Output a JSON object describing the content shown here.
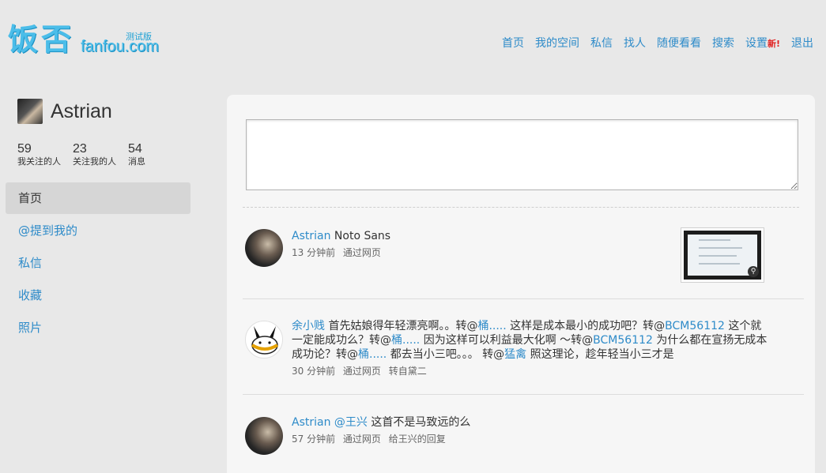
{
  "logo": {
    "cn": "饭否",
    "en": "fanfou.com",
    "beta": "测试版"
  },
  "nav": {
    "home": "首页",
    "my_space": "我的空间",
    "messages": "私信",
    "find_people": "找人",
    "browse": "随便看看",
    "search": "搜索",
    "settings": "设置",
    "settings_badge": "新!",
    "logout": "退出"
  },
  "profile": {
    "name": "Astrian"
  },
  "stats": [
    {
      "num": "59",
      "label": "我关注的人"
    },
    {
      "num": "23",
      "label": "关注我的人"
    },
    {
      "num": "54",
      "label": "消息"
    }
  ],
  "sidenav": [
    {
      "label": "首页",
      "active": true
    },
    {
      "label": "@提到我的"
    },
    {
      "label": "私信"
    },
    {
      "label": "收藏"
    },
    {
      "label": "照片"
    }
  ],
  "composer": {
    "placeholder": ""
  },
  "statuses": [
    {
      "user": "Astrian",
      "text": "Noto Sans",
      "time": "13 分钟前",
      "via": "通过网页"
    },
    {
      "user": "余小贱",
      "parts": [
        " 首先姑娘得年轻漂亮啊。。转@",
        "桶.....",
        " 这样是成本最小的成功吧？转@",
        "BCM56112",
        " 这个就一定能成功么？转@",
        "桶.....",
        " 因为这样可以利益最大化啊 ～转@",
        "BCM56112",
        " 为什么都在宣扬无成本成功论？转@",
        "桶.....",
        " 都去当小三吧。。。 转@",
        "猛禽",
        " 照这理论，趁年轻当小三才是"
      ],
      "time": "30 分钟前",
      "via": "通过网页",
      "extra": "转自黛二"
    },
    {
      "user": "Astrian",
      "mention": "@王兴",
      "text": " 这首不是马致远的么",
      "time": "57 分钟前",
      "via": "通过网页",
      "extra": "给王兴的回复"
    }
  ],
  "colors": {
    "link": "#2e8bc9",
    "logo": "#4bbde9",
    "badge": "#e02020",
    "panel": "#f6f6f6",
    "background": "#e8e8e8"
  },
  "icons": {
    "zoom": "magnifier-icon"
  }
}
